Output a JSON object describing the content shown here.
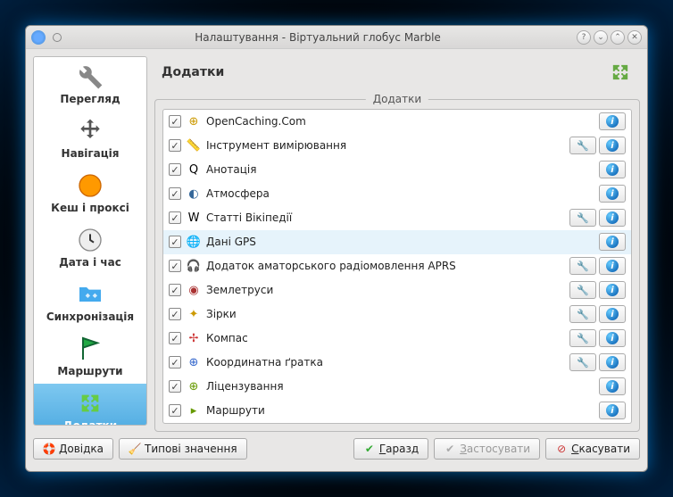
{
  "window": {
    "title": "Налаштування - Віртуальний глобус Marble"
  },
  "sidebar": {
    "items": [
      {
        "label": "Перегляд",
        "icon": "wrench"
      },
      {
        "label": "Навігація",
        "icon": "arrows"
      },
      {
        "label": "Кеш і проксі",
        "icon": "orange"
      },
      {
        "label": "Дата і час",
        "icon": "clock"
      },
      {
        "label": "Синхронізація",
        "icon": "folder"
      },
      {
        "label": "Маршрути",
        "icon": "flag"
      },
      {
        "label": "Додатки",
        "icon": "puzzle",
        "selected": true
      }
    ]
  },
  "main": {
    "title": "Додатки",
    "group_title": "Додатки"
  },
  "plugins": [
    {
      "label": "OpenCaching.Com",
      "icon": "⊕",
      "color": "#c90",
      "config": false,
      "info": true
    },
    {
      "label": "Інструмент вимірювання",
      "icon": "📏",
      "color": "#36c",
      "config": true,
      "info": true
    },
    {
      "label": "Анотація",
      "icon": "Q",
      "color": "#000",
      "config": false,
      "info": true
    },
    {
      "label": "Атмосфера",
      "icon": "◐",
      "color": "#369",
      "config": false,
      "info": true
    },
    {
      "label": "Статті Вікіпедії",
      "icon": "W",
      "color": "#000",
      "config": true,
      "info": true
    },
    {
      "label": "Дані GPS",
      "icon": "🌐",
      "color": "#36c",
      "config": false,
      "info": true,
      "selected": true
    },
    {
      "label": "Додаток аматорського радіомовлення APRS",
      "icon": "🎧",
      "color": "#555",
      "config": true,
      "info": true
    },
    {
      "label": "Землетруси",
      "icon": "◉",
      "color": "#a33",
      "config": true,
      "info": true
    },
    {
      "label": "Зірки",
      "icon": "✦",
      "color": "#c90",
      "config": true,
      "info": true
    },
    {
      "label": "Компас",
      "icon": "✢",
      "color": "#c33",
      "config": true,
      "info": true
    },
    {
      "label": "Координатна ґратка",
      "icon": "⊕",
      "color": "#36c",
      "config": true,
      "info": true
    },
    {
      "label": "Ліцензування",
      "icon": "⊕",
      "color": "#690",
      "config": false,
      "info": true
    },
    {
      "label": "Маршрути",
      "icon": "▸",
      "color": "#690",
      "config": false,
      "info": true
    }
  ],
  "buttons": {
    "help": "Довідка",
    "defaults": "Типові значення",
    "ok": "Гаразд",
    "apply": "Застосувати",
    "cancel": "Скасувати"
  }
}
